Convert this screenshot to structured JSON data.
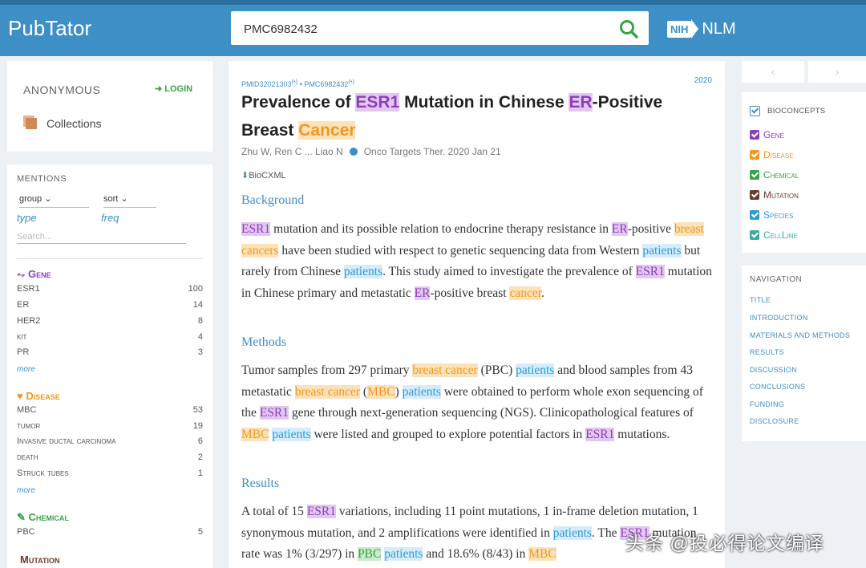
{
  "header": {
    "logo": "PubTator",
    "search_value": "PMC6982432",
    "nih_badge": "NIH",
    "nlm": "NLM"
  },
  "user": {
    "name": "ANONYMOUS",
    "login": "LOGIN",
    "collections": "Collections"
  },
  "mentions": {
    "header": "MENTIONS",
    "group": "group",
    "sort": "sort",
    "type": "type",
    "freq": "freq",
    "search_placeholder": "Search...",
    "more": "more",
    "gene": {
      "title": "Gene",
      "rows": [
        {
          "label": "ESR1",
          "count": "100"
        },
        {
          "label": "ER",
          "count": "14"
        },
        {
          "label": "HER2",
          "count": "8"
        },
        {
          "label": "kit",
          "count": "4"
        },
        {
          "label": "PR",
          "count": "3"
        }
      ]
    },
    "disease": {
      "title": "Disease",
      "rows": [
        {
          "label": "MBC",
          "count": "53"
        },
        {
          "label": "tumor",
          "count": "19"
        },
        {
          "label": "Invasive ductal carcinoma",
          "count": "6"
        },
        {
          "label": "death",
          "count": "2"
        },
        {
          "label": "Struck tubes",
          "count": "1"
        }
      ]
    },
    "chemical": {
      "title": "Chemical",
      "rows": [
        {
          "label": "PBC",
          "count": "5"
        }
      ]
    },
    "mutation": {
      "title": "Mutation"
    }
  },
  "article": {
    "pmid": "PMID32021303",
    "pmc": "PMC6982432",
    "year": "2020",
    "title": {
      "t1": "Prevalence of",
      "esr1": "ESR1",
      "t2": "Mutation in Chinese",
      "er": "ER",
      "t3": "-Positive Breast",
      "cancer": "Cancer"
    },
    "authors": "Zhu W, Ren C ... Liao N",
    "journal": "Onco Targets Ther. 2020 Jan 21",
    "bioc": "BioCXML",
    "background": {
      "heading": "Background",
      "w1": "ESR1",
      "w2": " mutation and its possible relation to endocrine therapy resistance in ",
      "w3": "ER",
      "w4": "-positive ",
      "w5": "breast cancers",
      "w6": " have been studied with respect to genetic sequencing data from Western ",
      "w7": "patients",
      "w8": " but rarely from Chinese ",
      "w9": "patients",
      "w10": ". This study aimed to investigate the prevalence of ",
      "w11": "ESR1",
      "w12": " mutation in Chinese primary and metastatic ",
      "w13": "ER",
      "w14": "-positive breast ",
      "w15": "cancer",
      "w16": "."
    },
    "methods": {
      "heading": "Methods",
      "w1": "Tumor samples from 297 primary ",
      "w2": "breast cancer",
      "w3": " (PBC) ",
      "w4": "patients",
      "w5": " and blood samples from 43 metastatic ",
      "w6": "breast cancer",
      "w7": " (",
      "w8": "MBC",
      "w9": ") ",
      "w10": "patients",
      "w11": " were obtained to perform whole exon sequencing of the ",
      "w12": "ESR1",
      "w13": " gene through next-generation sequencing (NGS). Clinicopathological features of ",
      "w14": "MBC",
      "w15": " ",
      "w16": "patients",
      "w17": " were listed and grouped to explore potential factors in ",
      "w18": "ESR1",
      "w19": " mutations."
    },
    "results": {
      "heading": "Results",
      "w1": "A total of 15 ",
      "w2": "ESR1",
      "w3": " variations, including 11 point mutations, 1 in-frame deletion mutation, 1 synonymous mutation, and 2 amplifications were identified in ",
      "w4": "patients",
      "w5": ". The ",
      "w6": "ESR1",
      "w7": " mutation rate was 1% (3/297) in ",
      "w8": "PBC",
      "w9": " ",
      "w10": "patients",
      "w11": " and 18.6% (8/43) in ",
      "w12": "MBC"
    }
  },
  "bioconcepts": {
    "header": "BIOCONCEPTS",
    "items": [
      {
        "label": "Gene",
        "color": "#8d3fb8"
      },
      {
        "label": "Disease",
        "color": "#f09820"
      },
      {
        "label": "Chemical",
        "color": "#3aa24a"
      },
      {
        "label": "Mutation",
        "color": "#6b3a2a"
      },
      {
        "label": "Species",
        "color": "#2e9bd8"
      },
      {
        "label": "CellLine",
        "color": "#3aad9a"
      }
    ]
  },
  "navigation": {
    "header": "NAVIGATION",
    "items": [
      "TITLE",
      "INTRODUCTION",
      "MATERIALS AND METHODS",
      "RESULTS",
      "DISCUSSION",
      "CONCLUSIONS",
      "FUNDING",
      "DISCLOSURE"
    ]
  },
  "watermark": "头条 @投必得论文编译"
}
